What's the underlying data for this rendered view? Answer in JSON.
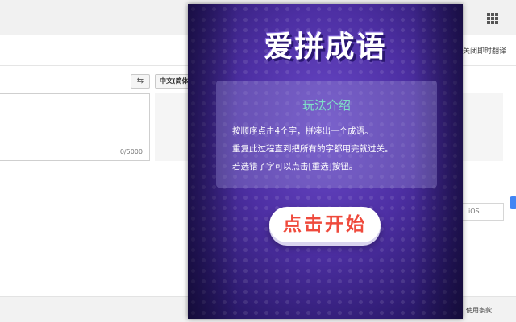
{
  "background_page": {
    "swap_icon": "⇆",
    "target_language_label": "中文(简体",
    "instant_translate_label": "关闭即时翻译",
    "char_count": "0/5000",
    "ios_label": "iOS",
    "terms_label": "使用条款"
  },
  "popup": {
    "title": "爱拼成语",
    "rules": {
      "heading": "玩法介绍",
      "lines": [
        "按顺序点击4个字，拼凑出一个成语。",
        "重复此过程直到把所有的字都用完就过关。",
        "若选错了字可以点击[重选]按钮。"
      ]
    },
    "start_button_label": "点击开始"
  },
  "colors": {
    "popup_purple": "#4d2fa3",
    "rules_heading": "#7fe0c7",
    "start_button_text": "#ef4a3c"
  }
}
